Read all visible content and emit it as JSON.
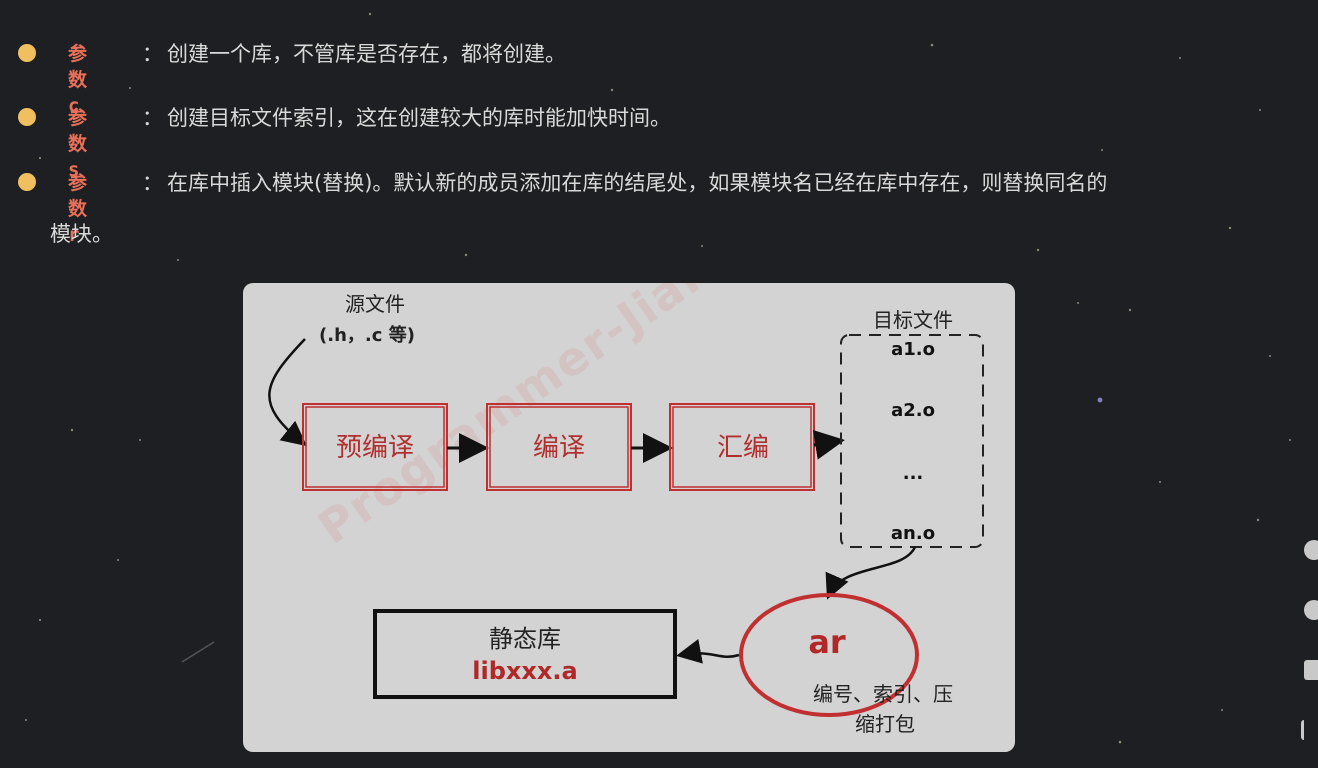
{
  "params": [
    {
      "key": "参数c",
      "sep": "：",
      "text": "创建一个库，不管库是否存在，都将创建。"
    },
    {
      "key": "参数s",
      "sep": "：",
      "text": "创建目标文件索引，这在创建较大的库时能加快时间。"
    },
    {
      "key": "参数r",
      "sep": "：",
      "text": "在库中插入模块(替换)。默认新的成员添加在库的结尾处，如果模块名已经在库中存在，则替换同名的",
      "continuation": "模块。"
    }
  ],
  "diagram": {
    "source_title": "源文件",
    "source_sub": "(.h，.c 等)",
    "steps": [
      "预编译",
      "编译",
      "汇编"
    ],
    "target_title": "目标文件",
    "objects": [
      "a1.o",
      "a2.o",
      "...",
      "an.o"
    ],
    "ar_label": "ar",
    "ar_desc_1": "编号、索引、压",
    "ar_desc_2": "缩打包",
    "lib_title": "静态库",
    "lib_name": "libxxx.a",
    "watermark": "Programmer-Jiangwen.cn 爱编程的大丙"
  },
  "sidebar": {
    "tools": [
      "gear-icon",
      "comment-icon",
      "barrage-icon",
      "back-to-top-icon"
    ]
  }
}
